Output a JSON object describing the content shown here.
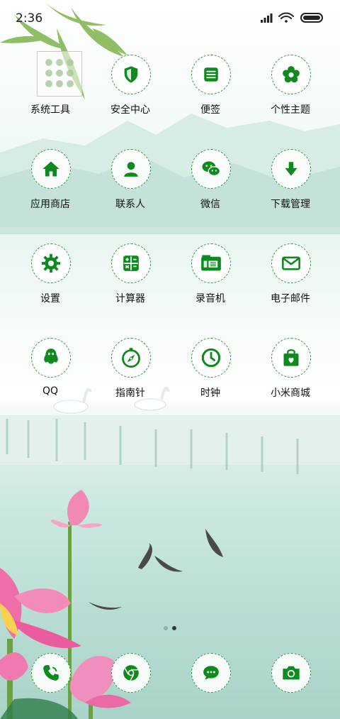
{
  "status": {
    "time": "2:36"
  },
  "apps": [
    {
      "name": "system-tools",
      "label": "系统工具",
      "icon": "folder-grid-icon"
    },
    {
      "name": "security-center",
      "label": "安全中心",
      "icon": "shield-icon"
    },
    {
      "name": "notes",
      "label": "便签",
      "icon": "notepad-icon"
    },
    {
      "name": "themes",
      "label": "个性主题",
      "icon": "flower-icon"
    },
    {
      "name": "app-store",
      "label": "应用商店",
      "icon": "home-icon"
    },
    {
      "name": "contacts",
      "label": "联系人",
      "icon": "person-icon"
    },
    {
      "name": "wechat",
      "label": "微信",
      "icon": "wechat-icon"
    },
    {
      "name": "download-manager",
      "label": "下载管理",
      "icon": "download-icon"
    },
    {
      "name": "settings",
      "label": "设置",
      "icon": "gear-icon"
    },
    {
      "name": "calculator",
      "label": "计算器",
      "icon": "calculator-icon"
    },
    {
      "name": "recorder",
      "label": "录音机",
      "icon": "recorder-icon"
    },
    {
      "name": "email",
      "label": "电子邮件",
      "icon": "mail-icon"
    },
    {
      "name": "qq",
      "label": "QQ",
      "icon": "penguin-icon"
    },
    {
      "name": "compass",
      "label": "指南针",
      "icon": "compass-icon"
    },
    {
      "name": "clock",
      "label": "时钟",
      "icon": "clock-icon"
    },
    {
      "name": "mi-store",
      "label": "小米商城",
      "icon": "shopping-bag-icon"
    }
  ],
  "dock": [
    {
      "name": "phone",
      "icon": "phone-icon"
    },
    {
      "name": "browser",
      "icon": "browser-icon"
    },
    {
      "name": "messages",
      "icon": "message-icon"
    },
    {
      "name": "camera",
      "icon": "camera-icon"
    }
  ],
  "page_indicator": {
    "pages": 2,
    "current": 2
  },
  "colors": {
    "accent": "#0f8a1e",
    "ring": "#2f9a3a"
  }
}
